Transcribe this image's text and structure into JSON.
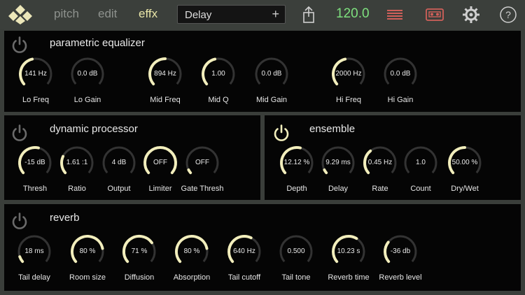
{
  "topbar": {
    "tabs": [
      "pitch",
      "edit",
      "effx"
    ],
    "preset_name": "Delay",
    "preset_add": "+",
    "tempo": "120.0",
    "colors": {
      "active_tab": "#e9e6a8",
      "tempo": "#7ee07e",
      "accent": "#f2eebc"
    }
  },
  "panels": {
    "eq": {
      "title": "parametric equalizer",
      "power_on": false,
      "knobs": [
        {
          "value": "141 Hz",
          "label": "Lo Freq",
          "level": 0.45
        },
        {
          "value": "0.0 dB",
          "label": "Lo Gain",
          "level": 0.0
        },
        {
          "value": "894 Hz",
          "label": "Mid Freq",
          "level": 0.5
        },
        {
          "value": "1.00",
          "label": "Mid Q",
          "level": 0.45
        },
        {
          "value": "0.0 dB",
          "label": "Mid Gain",
          "level": 0.0
        },
        {
          "value": "2000 Hz",
          "label": "Hi Freq",
          "level": 0.45
        },
        {
          "value": "0.0 dB",
          "label": "Hi Gain",
          "level": 0.0
        }
      ]
    },
    "dynamics": {
      "title": "dynamic processor",
      "power_on": false,
      "knobs": [
        {
          "value": "-15 dB",
          "label": "Thresh",
          "level": 0.55
        },
        {
          "value": "1.61 :1",
          "label": "Ratio",
          "level": 0.25
        },
        {
          "value": "4 dB",
          "label": "Output",
          "level": 0.0
        },
        {
          "value": "OFF",
          "label": "Limiter",
          "level": 1.0
        },
        {
          "value": "OFF",
          "label": "Gate Thresh",
          "level": 0.05
        }
      ]
    },
    "ensemble": {
      "title": "ensemble",
      "power_on": true,
      "knobs": [
        {
          "value": "12.12 %",
          "label": "Depth",
          "level": 0.55
        },
        {
          "value": "9.29  ms",
          "label": "Delay",
          "level": 0.05
        },
        {
          "value": "0.45  Hz",
          "label": "Rate",
          "level": 0.35
        },
        {
          "value": "1.0",
          "label": "Count",
          "level": 0.0
        },
        {
          "value": "50.00 %",
          "label": "Dry/Wet",
          "level": 0.5
        }
      ]
    },
    "reverb": {
      "title": "reverb",
      "power_on": false,
      "knobs": [
        {
          "value": "18 ms",
          "label": "Tail delay",
          "level": 0.08
        },
        {
          "value": "80 %",
          "label": "Room size",
          "level": 0.8
        },
        {
          "value": "71 %",
          "label": "Diffusion",
          "level": 0.71
        },
        {
          "value": "80 %",
          "label": "Absorption",
          "level": 0.8
        },
        {
          "value": "640 Hz",
          "label": "Tail cutoff",
          "level": 0.6
        },
        {
          "value": "0.500",
          "label": "Tail tone",
          "level": 0.0
        },
        {
          "value": "10.23 s",
          "label": "Reverb time",
          "level": 0.62
        },
        {
          "value": "-36 db",
          "label": "Reverb level",
          "level": 0.3
        }
      ]
    }
  }
}
